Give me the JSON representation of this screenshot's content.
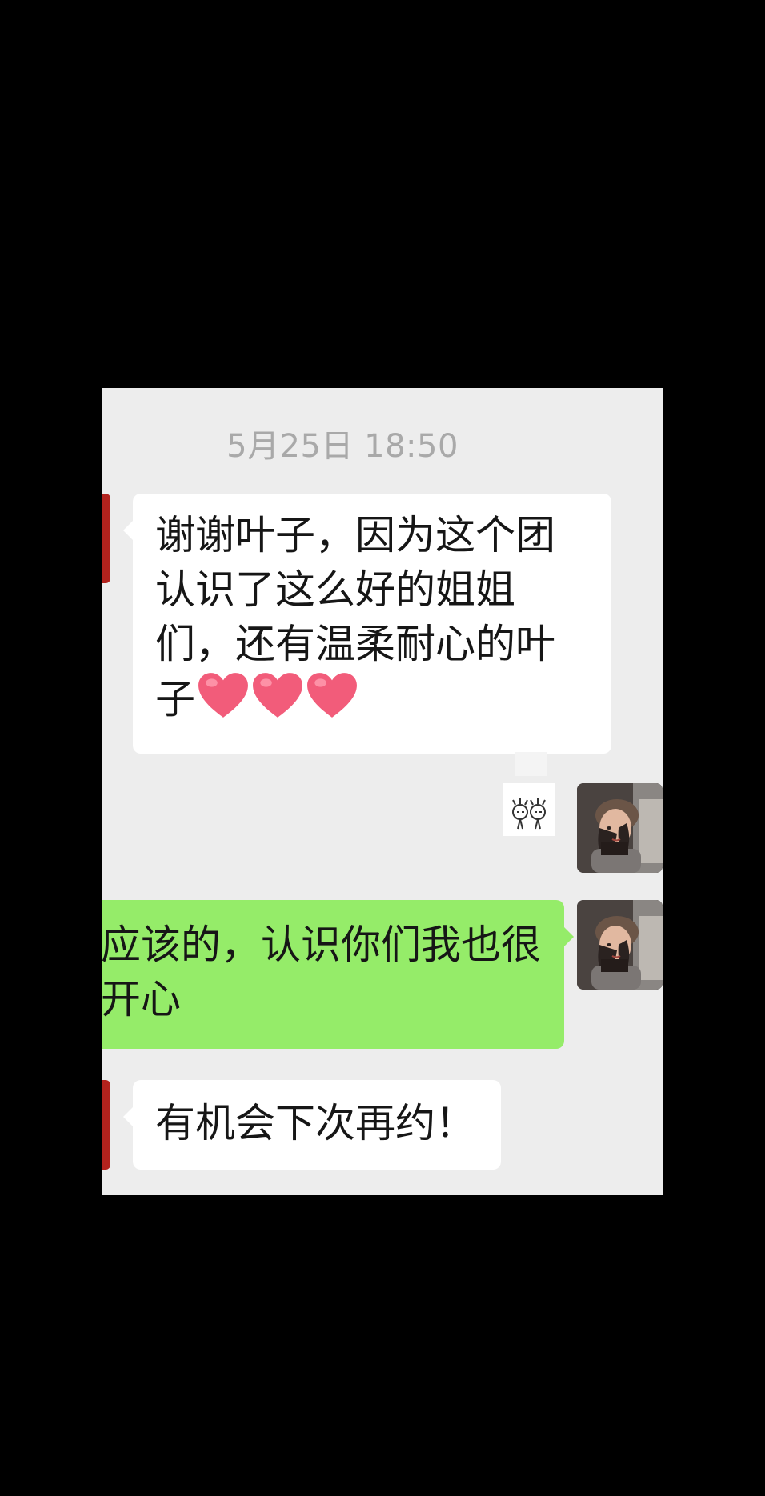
{
  "chat": {
    "timestamp": "5月25日 18:50",
    "messages": [
      {
        "sender": "other",
        "text": "谢谢叶子，因为这个团认识了这么好的姐姐们，还有温柔耐心的叶子",
        "emoji": [
          "heart",
          "heart",
          "heart"
        ]
      },
      {
        "sender": "self",
        "type": "sticker",
        "icon": "stick-figures-sticker"
      },
      {
        "sender": "self",
        "text": "应该的，认识你们我也很开心"
      },
      {
        "sender": "other",
        "text": "有机会下次再约！"
      }
    ]
  },
  "colors": {
    "chat_background": "#ededed",
    "incoming_bubble": "#ffffff",
    "outgoing_bubble": "#95ec69",
    "timestamp_text": "#a9a9a9",
    "other_avatar_edge": "#b2221d",
    "heart": "#f25c7a"
  }
}
